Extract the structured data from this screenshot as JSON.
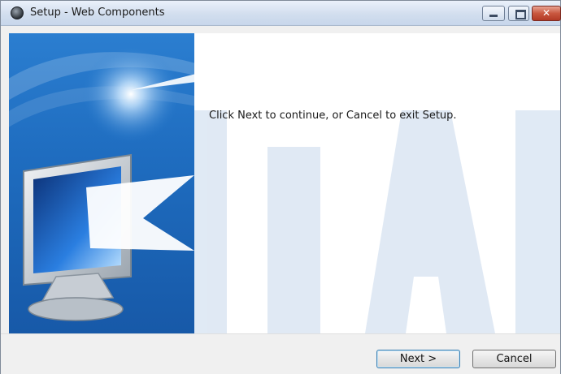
{
  "window": {
    "title": "Setup - Web Components",
    "controls": {
      "minimize_icon": "minimize-icon",
      "maximize_icon": "maximize-icon",
      "close_icon": "close-icon"
    }
  },
  "content": {
    "message": "Click Next to continue, or Cancel to exit Setup."
  },
  "footer": {
    "next_label": "Next >",
    "cancel_label": "Cancel"
  },
  "colors": {
    "banner_blue": "#1f6dc0",
    "watermark_blue": "#dbe6f3",
    "default_button_border": "#3c7fb1"
  }
}
